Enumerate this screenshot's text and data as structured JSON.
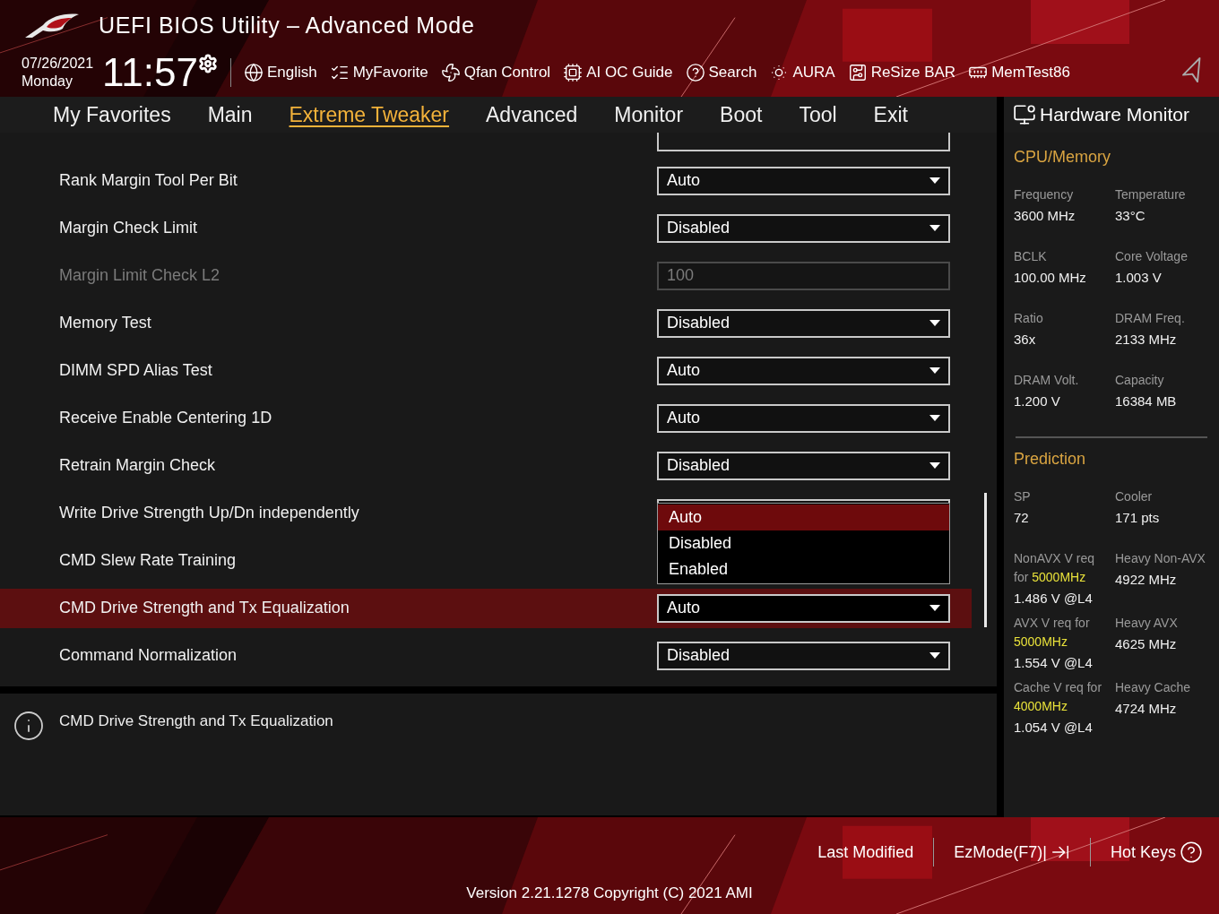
{
  "window": {
    "title": "UEFI BIOS Utility – Advanced Mode"
  },
  "datetime": {
    "date": "07/26/2021",
    "day": "Monday",
    "time": "11:57"
  },
  "toolbar": [
    {
      "label": "English",
      "kind": "language"
    },
    {
      "label": "MyFavorite",
      "kind": "favorite"
    },
    {
      "label": "Qfan Control",
      "kind": "fan"
    },
    {
      "label": "AI OC Guide",
      "kind": "guide"
    },
    {
      "label": "Search",
      "kind": "search"
    },
    {
      "label": "AURA",
      "kind": "aura"
    },
    {
      "label": "ReSize BAR",
      "kind": "resize"
    },
    {
      "label": "MemTest86",
      "kind": "memtest"
    }
  ],
  "tabs": [
    {
      "label": "My Favorites",
      "selected": false
    },
    {
      "label": "Main",
      "selected": false
    },
    {
      "label": "Extreme Tweaker",
      "selected": true
    },
    {
      "label": "Advanced",
      "selected": false
    },
    {
      "label": "Monitor",
      "selected": false
    },
    {
      "label": "Boot",
      "selected": false
    },
    {
      "label": "Tool",
      "selected": false
    },
    {
      "label": "Exit",
      "selected": false
    }
  ],
  "settings": [
    {
      "label": "Rank Margin Tool Per Bit",
      "kind": "select",
      "value": "Auto",
      "disabled": false,
      "selected": false
    },
    {
      "label": "Margin Check Limit",
      "kind": "select",
      "value": "Disabled",
      "disabled": false,
      "selected": false
    },
    {
      "label": "Margin Limit Check L2",
      "kind": "field",
      "value": "100",
      "disabled": true,
      "selected": false
    },
    {
      "label": "Memory Test",
      "kind": "select",
      "value": "Disabled",
      "disabled": false,
      "selected": false
    },
    {
      "label": "DIMM SPD Alias Test",
      "kind": "select",
      "value": "Auto",
      "disabled": false,
      "selected": false
    },
    {
      "label": "Receive Enable Centering 1D",
      "kind": "select",
      "value": "Auto",
      "disabled": false,
      "selected": false
    },
    {
      "label": "Retrain Margin Check",
      "kind": "select",
      "value": "Disabled",
      "disabled": false,
      "selected": false
    },
    {
      "label": "Write Drive Strength Up/Dn independently",
      "kind": "open-select",
      "disabled": false,
      "selected": false,
      "options": [
        {
          "label": "Auto",
          "selected": true
        },
        {
          "label": "Disabled",
          "selected": false
        },
        {
          "label": "Enabled",
          "selected": false
        }
      ]
    },
    {
      "label": "CMD Slew Rate Training",
      "kind": "covered",
      "disabled": false,
      "selected": false
    },
    {
      "label": "CMD Drive Strength and Tx Equalization",
      "kind": "select",
      "value": "Auto",
      "disabled": false,
      "selected": true
    },
    {
      "label": "Command Normalization",
      "kind": "select",
      "value": "Disabled",
      "disabled": false,
      "selected": false
    }
  ],
  "help": {
    "text": "CMD Drive Strength and Tx Equalization"
  },
  "hardware_monitor": {
    "title": "Hardware Monitor",
    "sections": [
      {
        "title": "CPU/Memory",
        "kind": "spaced",
        "items": [
          {
            "label": "Frequency",
            "value": "3600 MHz"
          },
          {
            "label": "Temperature",
            "value": "33°C"
          },
          {
            "label": "BCLK",
            "value": "100.00 MHz"
          },
          {
            "label": "Core Voltage",
            "value": "1.003 V"
          },
          {
            "label": "Ratio",
            "value": "36x"
          },
          {
            "label": "DRAM Freq.",
            "value": "2133 MHz"
          },
          {
            "label": "DRAM Volt.",
            "value": "1.200 V"
          },
          {
            "label": "Capacity",
            "value": "16384 MB"
          }
        ]
      },
      {
        "title": "Prediction",
        "kind": "compact",
        "items": [
          {
            "label": "SP",
            "value": "72"
          },
          {
            "label": "Cooler",
            "value": "171 pts"
          },
          {
            "label": "NonAVX V req for **5000MHz**",
            "value": "1.486 V @L4"
          },
          {
            "label": "Heavy Non-AVX",
            "value": "4922 MHz"
          },
          {
            "label": "AVX V req for **5000MHz**",
            "value": "1.554 V @L4"
          },
          {
            "label": "Heavy AVX",
            "value": "4625 MHz"
          },
          {
            "label": "Cache V req for **4000MHz**",
            "value": "1.054 V @L4"
          },
          {
            "label": "Heavy Cache",
            "value": "4724 MHz"
          }
        ]
      }
    ]
  },
  "footer": {
    "buttons": [
      {
        "label": "Last Modified",
        "kind": "plain"
      },
      {
        "label": "EzMode(F7)|",
        "kind": "ezmode"
      },
      {
        "label": "Hot Keys",
        "kind": "hotkeys"
      }
    ],
    "version": "Version 2.21.1278 Copyright (C) 2021 AMI"
  }
}
